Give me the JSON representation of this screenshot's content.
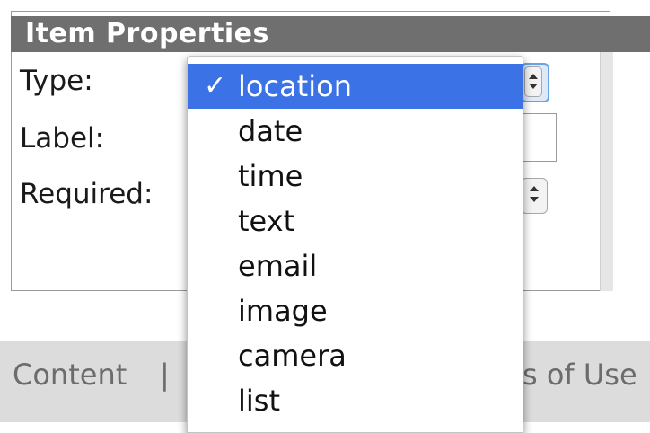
{
  "panel": {
    "title": "Item Properties",
    "fields": {
      "type_label": "Type:",
      "label_label": "Label:",
      "required_label": "Required:"
    }
  },
  "dropdown": {
    "selected_mark": "✓",
    "options": [
      {
        "label": "location",
        "selected": true
      },
      {
        "label": "date",
        "selected": false
      },
      {
        "label": "time",
        "selected": false
      },
      {
        "label": "text",
        "selected": false
      },
      {
        "label": "email",
        "selected": false
      },
      {
        "label": "image",
        "selected": false
      },
      {
        "label": "camera",
        "selected": false
      },
      {
        "label": "list",
        "selected": false
      }
    ]
  },
  "footer": {
    "content_link": "Content",
    "separator": "|",
    "terms_link_partial": "s of Use"
  },
  "colors": {
    "header_bg": "#6f6f6f",
    "selection_bg": "#3b72e6",
    "footer_bg": "#dcdcdc"
  }
}
